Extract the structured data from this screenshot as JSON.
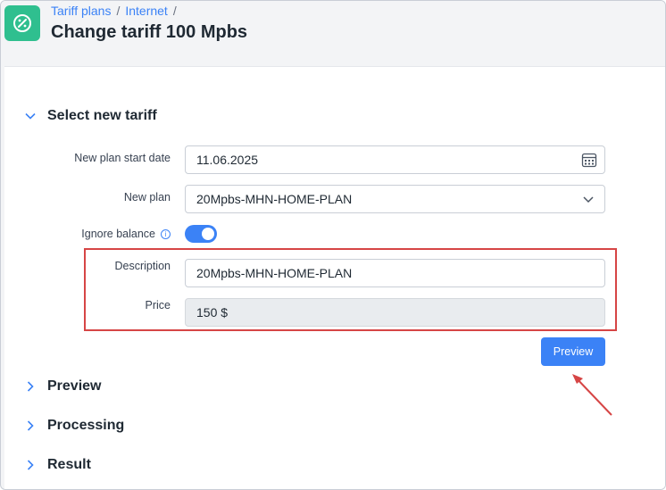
{
  "breadcrumb": {
    "items": [
      "Tariff plans",
      "Internet"
    ],
    "separator": "/"
  },
  "page": {
    "title": "Change tariff 100 Mpbs"
  },
  "sections": {
    "select_new_tariff": "Select new tariff",
    "preview": "Preview",
    "processing": "Processing",
    "result": "Result"
  },
  "form": {
    "start_date_label": "New plan start date",
    "start_date_value": "11.06.2025",
    "new_plan_label": "New plan",
    "new_plan_value": "20Mpbs-MHN-HOME-PLAN",
    "ignore_balance_label": "Ignore balance",
    "ignore_balance_on": true,
    "description_label": "Description",
    "description_value": "20Mpbs-MHN-HOME-PLAN",
    "price_label": "Price",
    "price_value": "150 $"
  },
  "buttons": {
    "preview": "Preview"
  },
  "colors": {
    "accent": "#3b82f6",
    "brand": "#2fbf8f",
    "highlight": "#d64545"
  },
  "icons": [
    "percent-badge-icon",
    "calendar-icon",
    "chevron-down-icon",
    "chevron-right-icon",
    "info-icon"
  ]
}
